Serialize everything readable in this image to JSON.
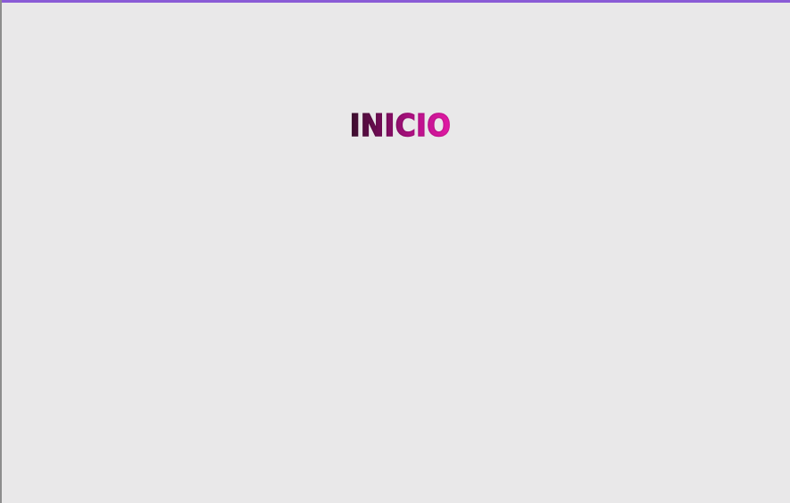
{
  "page": {
    "title": "INICIO"
  },
  "colors": {
    "background": "#e9e8e9",
    "top_accent": "#8a5bd6",
    "title_gradient_start": "#3b0f2d",
    "title_gradient_end": "#e21aa4"
  }
}
